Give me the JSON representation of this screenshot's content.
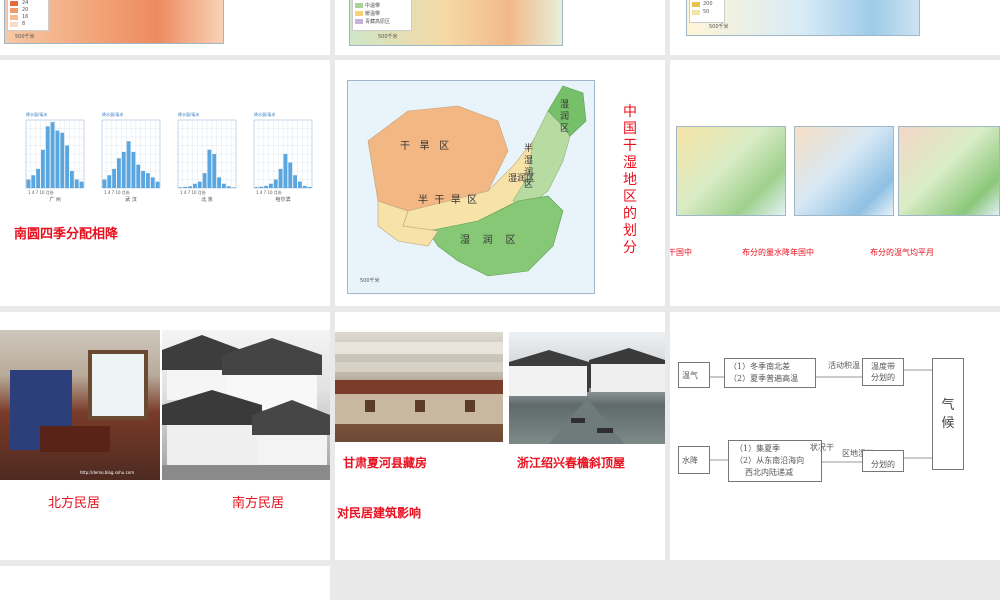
{
  "slide_top_left": {
    "legend_values": [
      "24",
      "20",
      "16",
      "8"
    ],
    "scale": "500千米"
  },
  "slide_top_mid": {
    "legend_items": [
      "中温带",
      "暖温带",
      "青藏高原区"
    ],
    "scale": "500千米"
  },
  "slide_top_right": {
    "legend_values": [
      "200",
      "50"
    ],
    "scale": "500千米"
  },
  "slide_precip": {
    "caption": "南圆四季分配相降",
    "charts": [
      {
        "city": "广 州",
        "ylabel": "降水量/毫米",
        "values": [
          40,
          60,
          90,
          180,
          290,
          310,
          270,
          260,
          200,
          80,
          40,
          30
        ]
      },
      {
        "city": "武 汉",
        "ylabel": "降水量/毫米",
        "values": [
          40,
          60,
          90,
          140,
          170,
          220,
          170,
          110,
          80,
          70,
          50,
          30
        ]
      },
      {
        "city": "北 京",
        "ylabel": "降水量/毫米",
        "values": [
          3,
          5,
          8,
          20,
          30,
          70,
          180,
          160,
          50,
          20,
          8,
          3
        ]
      },
      {
        "city": "哈尔滨",
        "ylabel": "降水量/毫米",
        "values": [
          4,
          6,
          10,
          20,
          40,
          90,
          160,
          120,
          60,
          30,
          10,
          5
        ]
      }
    ],
    "month_ticks": "1  4  7  10 月份"
  },
  "slide_dryhumid": {
    "title": "中国干湿地区的划分",
    "regions": [
      "干",
      "旱",
      "区",
      "半",
      "干",
      "旱",
      "区",
      "湿",
      "润",
      "区",
      "半",
      "湿",
      "润",
      "区",
      "湿",
      "润",
      "区",
      "湿",
      "润",
      "区"
    ],
    "scale": "500千米"
  },
  "slide_three_maps": {
    "captions": [
      "干国中",
      "布分的量水降年国中",
      "布分的温气均平月"
    ]
  },
  "slide_houses": {
    "caption_left": "北方民居",
    "caption_right": "南方民居",
    "watermark": "http://demo.blog.sohu.com"
  },
  "slide_houses2": {
    "caption_left": "甘肃夏河县藏房",
    "caption_right": "浙江绍兴春檐斜顶屋",
    "caption_bottom": "对民居建筑影响"
  },
  "slide_flow": {
    "left_top": "温气",
    "left_bottom": "水降",
    "box1_line1": "（1）冬季南北差",
    "box1_line2": "（2）夏季普遍高温",
    "box2_line1": "（1）集夏季",
    "box2_line2": "（2）从东南沿海向",
    "box2_line3": "西北内陆递减",
    "mid_top_label": "活动积温",
    "mid_top_box": "温度带\n分划的",
    "mid_bottom_label1": "状况干",
    "mid_bottom_label2": "区地湿干",
    "mid_bottom_box": "分划的",
    "right_box": "气\n候"
  }
}
